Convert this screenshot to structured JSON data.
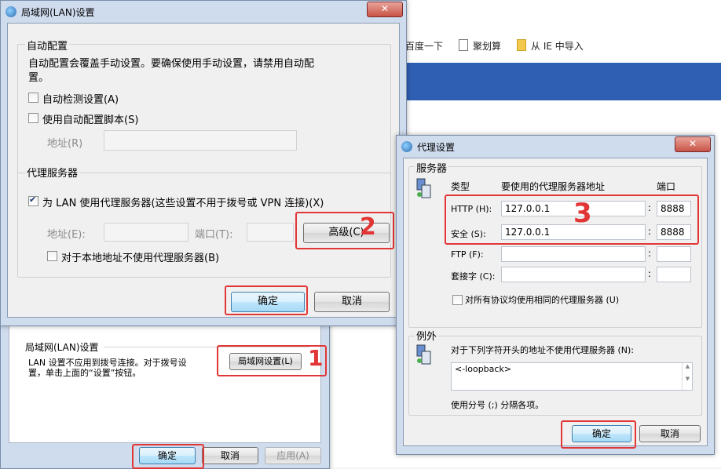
{
  "browser": {
    "bookmarks": [
      "百度一下",
      "聚划算",
      "从 IE 中导入"
    ]
  },
  "lan_dialog": {
    "title": "局域网(LAN)设置",
    "close": "✕",
    "auto_config": {
      "legend": "自动配置",
      "description_line1": "自动配置会覆盖手动设置。要确保使用手动设置，请禁用自动配",
      "description_line2": "置。",
      "auto_detect_label": "自动检测设置(A)",
      "auto_detect_checked": false,
      "use_script_label": "使用自动配置脚本(S)",
      "use_script_checked": false,
      "address_label": "地址(R)",
      "address_value": ""
    },
    "proxy": {
      "legend": "代理服务器",
      "use_proxy_label": "为 LAN 使用代理服务器(这些设置不用于拨号或 VPN 连接)(X)",
      "use_proxy_checked": true,
      "address_label": "地址(E):",
      "address_value": "",
      "port_label": "端口(T):",
      "port_value": "",
      "advanced_button": "高级(C)",
      "bypass_local_label": "对于本地地址不使用代理服务器(B)",
      "bypass_local_checked": false
    },
    "ok": "确定",
    "cancel": "取消"
  },
  "internet_options": {
    "lan_section_title": "局域网(LAN)设置",
    "lan_section_text_line1": "LAN 设置不应用到拨号连接。对于拨号设",
    "lan_section_text_line2": "置，单击上面的“设置”按钮。",
    "lan_settings_button": "局域网设置(L)",
    "ok": "确定",
    "cancel": "取消",
    "apply": "应用(A)"
  },
  "proxy_dialog": {
    "title": "代理设置",
    "close": "✕",
    "servers": {
      "legend": "服务器",
      "col_type": "类型",
      "col_address": "要使用的代理服务器地址",
      "col_port": "端口",
      "rows": [
        {
          "type": "HTTP (H):",
          "address": "127.0.0.1",
          "port": "8888"
        },
        {
          "type": "安全 (S):",
          "address": "127.0.0.1",
          "port": "8888"
        },
        {
          "type": "FTP (F):",
          "address": "",
          "port": ""
        },
        {
          "type": "套接字 (C):",
          "address": "",
          "port": ""
        }
      ],
      "same_proxy_label": "对所有协议均使用相同的代理服务器 (U)",
      "same_proxy_checked": false
    },
    "exceptions": {
      "legend": "例外",
      "description": "对于下列字符开头的地址不使用代理服务器 (N):",
      "value": "<-loopback>",
      "hint": "使用分号 (;) 分隔各项。"
    },
    "ok": "确定",
    "cancel": "取消"
  },
  "annotations": {
    "step1": "1",
    "step2": "2",
    "step3": "3",
    "color": "#e23535"
  }
}
